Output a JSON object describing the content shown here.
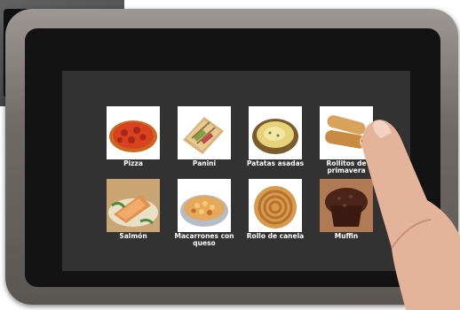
{
  "menu": {
    "items": [
      {
        "label": "Pizza",
        "icon": "pizza-icon"
      },
      {
        "label": "Panini",
        "icon": "panini-icon"
      },
      {
        "label": "Patatas asadas",
        "icon": "baked-potato-icon"
      },
      {
        "label": "Rollitos de primavera",
        "icon": "spring-roll-icon"
      },
      {
        "label": "Salmón",
        "icon": "salmon-icon"
      },
      {
        "label": "Macarrones con queso",
        "icon": "mac-and-cheese-icon"
      },
      {
        "label": "Rollo de canela",
        "icon": "cinnamon-roll-icon"
      },
      {
        "label": "Muffin",
        "icon": "muffin-icon"
      }
    ]
  },
  "colors": {
    "screen": "#323232",
    "bezel": "#131313",
    "frame": "#7a7571",
    "label": "#ffffff"
  }
}
